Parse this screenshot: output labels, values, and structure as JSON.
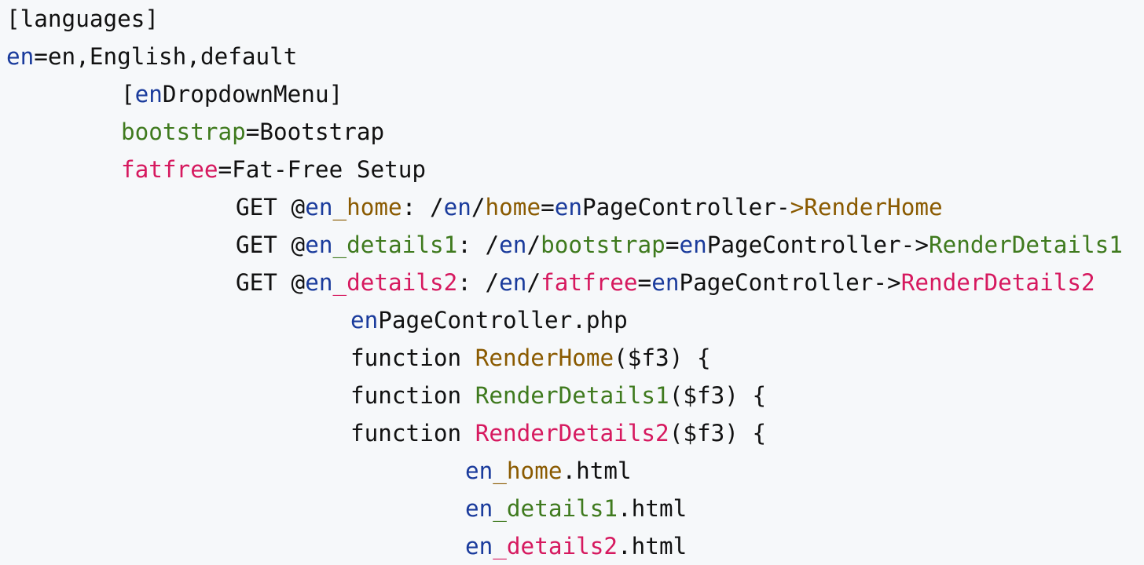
{
  "colors": {
    "background": "#f6f8fa",
    "default": "#111111",
    "blue": "#1a3b9c",
    "brown": "#8a5a00",
    "green": "#3f7a1e",
    "magenta": "#d6195f"
  },
  "code": {
    "language": "ini",
    "lines": [
      {
        "indent": 0,
        "tokens": [
          {
            "text": "[languages]",
            "color": "default"
          }
        ]
      },
      {
        "indent": 0,
        "tokens": [
          {
            "text": "en",
            "color": "blue"
          },
          {
            "text": "=en,English,default",
            "color": "default"
          }
        ]
      },
      {
        "indent": 1,
        "tokens": [
          {
            "text": "[",
            "color": "default"
          },
          {
            "text": "en",
            "color": "blue"
          },
          {
            "text": "DropdownMenu]",
            "color": "default"
          }
        ]
      },
      {
        "indent": 1,
        "tokens": [
          {
            "text": "bootstrap",
            "color": "green"
          },
          {
            "text": "=Bootstrap",
            "color": "default"
          }
        ]
      },
      {
        "indent": 1,
        "tokens": [
          {
            "text": "fatfree",
            "color": "magenta"
          },
          {
            "text": "=Fat-Free Setup",
            "color": "default"
          }
        ]
      },
      {
        "indent": 2,
        "tokens": [
          {
            "text": "GET @",
            "color": "default"
          },
          {
            "text": "en",
            "color": "blue"
          },
          {
            "text": "_home",
            "color": "brown"
          },
          {
            "text": ": /",
            "color": "default"
          },
          {
            "text": "en",
            "color": "blue"
          },
          {
            "text": "/",
            "color": "default"
          },
          {
            "text": "home",
            "color": "brown"
          },
          {
            "text": "=",
            "color": "default"
          },
          {
            "text": "en",
            "color": "blue"
          },
          {
            "text": "PageController-",
            "color": "default"
          },
          {
            "text": ">RenderHome",
            "color": "brown"
          }
        ]
      },
      {
        "indent": 2,
        "tokens": [
          {
            "text": "GET @",
            "color": "default"
          },
          {
            "text": "en",
            "color": "blue"
          },
          {
            "text": "_details1",
            "color": "green"
          },
          {
            "text": ": /",
            "color": "default"
          },
          {
            "text": "en",
            "color": "blue"
          },
          {
            "text": "/",
            "color": "default"
          },
          {
            "text": "bootstrap",
            "color": "green"
          },
          {
            "text": "=",
            "color": "default"
          },
          {
            "text": "en",
            "color": "blue"
          },
          {
            "text": "PageController->",
            "color": "default"
          },
          {
            "text": "RenderDetails1",
            "color": "green"
          }
        ]
      },
      {
        "indent": 2,
        "tokens": [
          {
            "text": "GET @",
            "color": "default"
          },
          {
            "text": "en",
            "color": "blue"
          },
          {
            "text": "_details2",
            "color": "magenta"
          },
          {
            "text": ": /",
            "color": "default"
          },
          {
            "text": "en",
            "color": "blue"
          },
          {
            "text": "/",
            "color": "default"
          },
          {
            "text": "fatfree",
            "color": "magenta"
          },
          {
            "text": "=",
            "color": "default"
          },
          {
            "text": "en",
            "color": "blue"
          },
          {
            "text": "PageController->",
            "color": "default"
          },
          {
            "text": "RenderDetails2",
            "color": "magenta"
          }
        ]
      },
      {
        "indent": 3,
        "tokens": [
          {
            "text": "en",
            "color": "blue"
          },
          {
            "text": "PageController.php",
            "color": "default"
          }
        ]
      },
      {
        "indent": 3,
        "tokens": [
          {
            "text": "function ",
            "color": "default"
          },
          {
            "text": "RenderHome",
            "color": "brown"
          },
          {
            "text": "($f3) {",
            "color": "default"
          }
        ]
      },
      {
        "indent": 3,
        "tokens": [
          {
            "text": "function ",
            "color": "default"
          },
          {
            "text": "RenderDetails1",
            "color": "green"
          },
          {
            "text": "($f3) {",
            "color": "default"
          }
        ]
      },
      {
        "indent": 3,
        "tokens": [
          {
            "text": "function ",
            "color": "default"
          },
          {
            "text": "RenderDetails2",
            "color": "magenta"
          },
          {
            "text": "($f3) {",
            "color": "default"
          }
        ]
      },
      {
        "indent": 4,
        "tokens": [
          {
            "text": "en",
            "color": "blue"
          },
          {
            "text": "_home",
            "color": "brown"
          },
          {
            "text": ".html",
            "color": "default"
          }
        ]
      },
      {
        "indent": 4,
        "tokens": [
          {
            "text": "en",
            "color": "blue"
          },
          {
            "text": "_details1",
            "color": "green"
          },
          {
            "text": ".html",
            "color": "default"
          }
        ]
      },
      {
        "indent": 4,
        "tokens": [
          {
            "text": "en",
            "color": "blue"
          },
          {
            "text": "_details2",
            "color": "magenta"
          },
          {
            "text": ".html",
            "color": "default"
          }
        ]
      }
    ]
  }
}
